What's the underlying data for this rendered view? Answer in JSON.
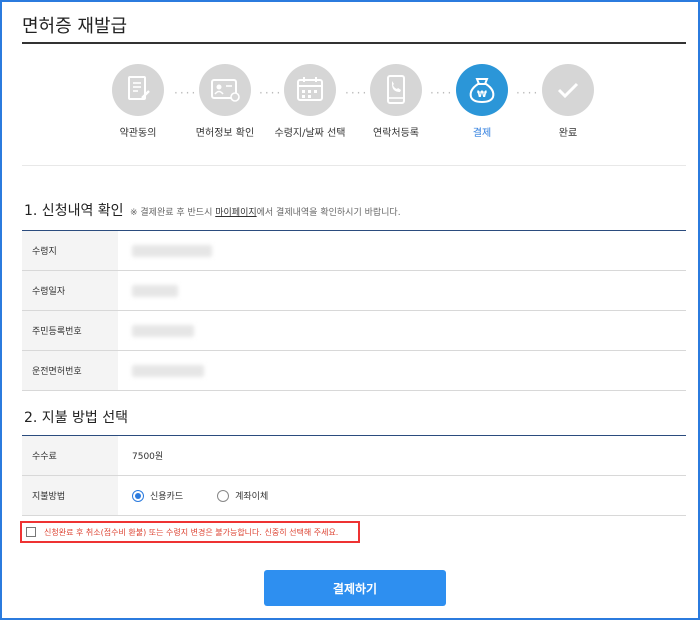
{
  "page": {
    "title": "면허증 재발급"
  },
  "steps": [
    {
      "label": "약관동의",
      "icon": "document-icon",
      "active": false
    },
    {
      "label": "면허정보 확인",
      "icon": "id-card-icon",
      "active": false
    },
    {
      "label": "수령지/날짜 선택",
      "icon": "calendar-icon",
      "active": false
    },
    {
      "label": "연락처등록",
      "icon": "phone-icon",
      "active": false
    },
    {
      "label": "결제",
      "icon": "money-bag-icon",
      "active": true
    },
    {
      "label": "완료",
      "icon": "check-icon",
      "active": false
    }
  ],
  "section1": {
    "title": "1. 신청내역 확인",
    "note_prefix": "※ 결제완료 후 반드시 ",
    "note_link": "마이페이지",
    "note_suffix": "에서 결제내역을 확인하시기 바랍니다.",
    "rows": [
      {
        "label": "수령지"
      },
      {
        "label": "수령일자"
      },
      {
        "label": "주민등록번호"
      },
      {
        "label": "운전면허번호"
      }
    ]
  },
  "section2": {
    "title": "2. 지불 방법 선택",
    "fee_label": "수수료",
    "fee_value": "7500원",
    "method_label": "지불방법",
    "options": [
      {
        "label": "신용카드",
        "checked": true
      },
      {
        "label": "계좌이체",
        "checked": false
      }
    ]
  },
  "agreement": {
    "text": "신청완료 후 취소(접수비 환불) 또는 수령지 변경은 불가능합니다. 신중히 선택해 주세요."
  },
  "pay_button": {
    "label": "결제하기"
  },
  "colors": {
    "accent": "#2b7bde",
    "active_step": "#2b96d8",
    "button": "#2e8ff0",
    "warning": "#e33333"
  }
}
